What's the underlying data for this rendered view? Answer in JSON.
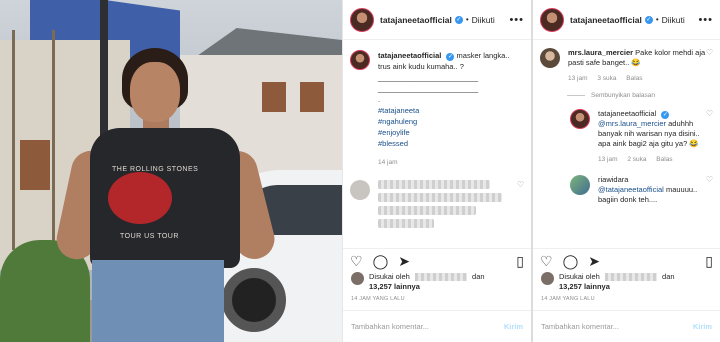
{
  "post": {
    "username": "tatajaneetaofficial",
    "follow_status": "Diikuti",
    "caption_line1": "masker langka..",
    "caption_line2": "trus aink kudu kumaha.. ?",
    "caption_divider1": "________________________",
    "caption_divider2": "________________________",
    "caption_dot": ".",
    "hashtags": [
      "#tatajaneeta",
      "#ngahuleng",
      "#enjoylife",
      "#blessed"
    ],
    "time": "14 jam",
    "likes_prefix": "Disukai oleh",
    "likes_suffix": "dan",
    "likes_count": "13,257 lainnya",
    "timestamp": "14 JAM YANG LALU",
    "comment_placeholder": "Tambahkan komentar...",
    "send_label": "Kirim",
    "shirt_text_top": "THE ROLLING STONES",
    "shirt_text_bottom": "TOUR US TOUR"
  },
  "thread": {
    "comment1": {
      "username": "mrs.laura_mercier",
      "text": "Pake kolor mehdi aja pasti safe banget..",
      "emoji": "😂",
      "time": "13 jam",
      "likes": "3 suka",
      "reply": "Balas"
    },
    "hide_replies": "Sembunyikan balasan",
    "reply1": {
      "username": "tatajaneetaofficial",
      "mention": "@mrs.laura_mercier",
      "text": "aduhhh banyak nih warisan nya disini.. apa aink bagi2 aja gitu ya?",
      "emoji": "😂",
      "time": "13 jam",
      "likes": "2 suka",
      "reply": "Balas"
    },
    "reply2": {
      "username": "riawidara",
      "mention": "@tatajaneetaofficial",
      "text": "mauuuu.. bagiin donk teh...."
    }
  },
  "icons": [
    "verified-icon",
    "more-icon",
    "heart-icon",
    "comment-icon",
    "share-icon",
    "bookmark-icon"
  ]
}
